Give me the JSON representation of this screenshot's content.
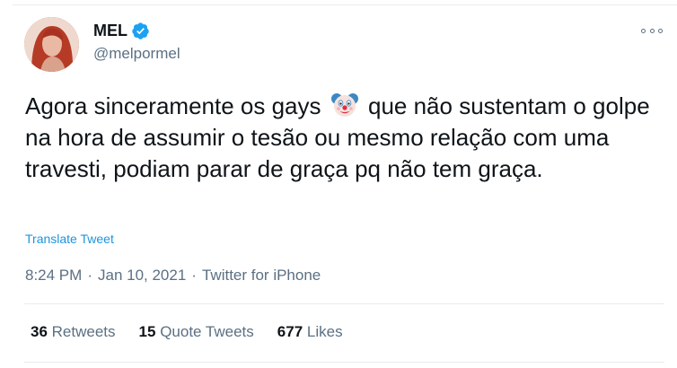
{
  "author": {
    "display_name": "MEL",
    "handle": "@melpormel",
    "verified": true
  },
  "tweet": {
    "text_before_emoji": "Agora sinceramente os gays",
    "emoji": "clown-face",
    "text_after_emoji": "que não sustentam o golpe na hora de assumir o tesão ou mesmo relação com uma travesti, podiam parar de graça pq não tem graça.",
    "translate_label": "Translate Tweet"
  },
  "meta": {
    "time": "8:24 PM",
    "separator": "·",
    "date": "Jan 10, 2021",
    "source": "Twitter for iPhone"
  },
  "stats": {
    "retweets_count": "36",
    "retweets_label": "Retweets",
    "quotes_count": "15",
    "quotes_label": "Quote Tweets",
    "likes_count": "677",
    "likes_label": "Likes"
  },
  "colors": {
    "accent": "#1b95e0",
    "verified": "#1da1f2",
    "secondary_text": "#5b7083",
    "primary_text": "#0f1419"
  }
}
